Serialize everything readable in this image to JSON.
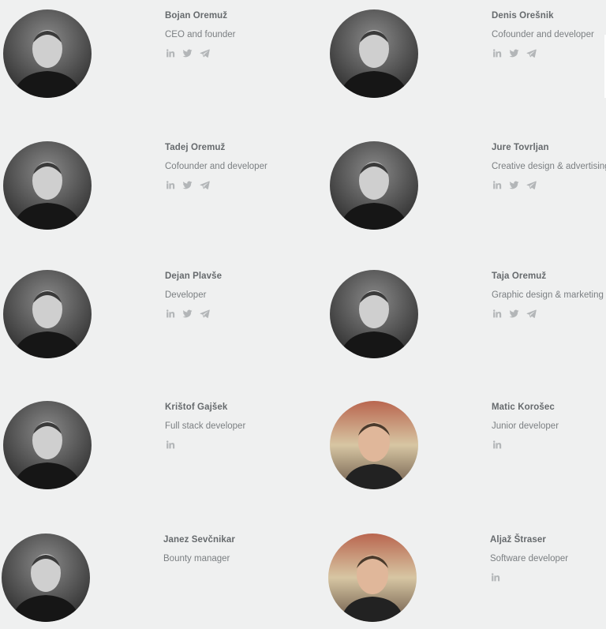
{
  "team": [
    {
      "name": "Bojan Oremuž",
      "role": "CEO and founder",
      "photo": "grayscale",
      "social": [
        "linkedin-icon",
        "twitter-icon",
        "telegram-icon"
      ]
    },
    {
      "name": "Denis Orešnik",
      "role": "Cofounder and developer",
      "photo": "grayscale",
      "social": [
        "linkedin-icon",
        "twitter-icon",
        "telegram-icon"
      ]
    },
    {
      "name": "Tadej Oremuž",
      "role": "Cofounder and developer",
      "photo": "grayscale",
      "social": [
        "linkedin-icon",
        "twitter-icon",
        "telegram-icon"
      ]
    },
    {
      "name": "Jure Tovrljan",
      "role": "Creative design & advertising",
      "photo": "grayscale",
      "social": [
        "linkedin-icon",
        "twitter-icon",
        "telegram-icon"
      ]
    },
    {
      "name": "Dejan Plavše",
      "role": "Developer",
      "photo": "grayscale",
      "social": [
        "linkedin-icon",
        "twitter-icon",
        "telegram-icon"
      ]
    },
    {
      "name": "Taja Oremuž",
      "role": "Graphic design & marketing",
      "photo": "grayscale",
      "social": [
        "linkedin-icon",
        "twitter-icon",
        "telegram-icon"
      ]
    },
    {
      "name": "Krištof Gajšek",
      "role": "Full stack developer",
      "photo": "grayscale",
      "social": [
        "linkedin-icon"
      ]
    },
    {
      "name": "Matic Korošec",
      "role": "Junior developer",
      "photo": "color",
      "social": [
        "linkedin-icon"
      ]
    },
    {
      "name": "Janez Sevčnikar",
      "role": "Bounty manager",
      "photo": "grayscale",
      "social": []
    },
    {
      "name": "Aljaž Štraser",
      "role": "Software developer",
      "photo": "color",
      "social": [
        "linkedin-icon"
      ]
    }
  ],
  "colors": {
    "background": "#eff0f0",
    "name": "#666a6d",
    "role": "#7b7f82",
    "icon": "#b3b6b8"
  }
}
